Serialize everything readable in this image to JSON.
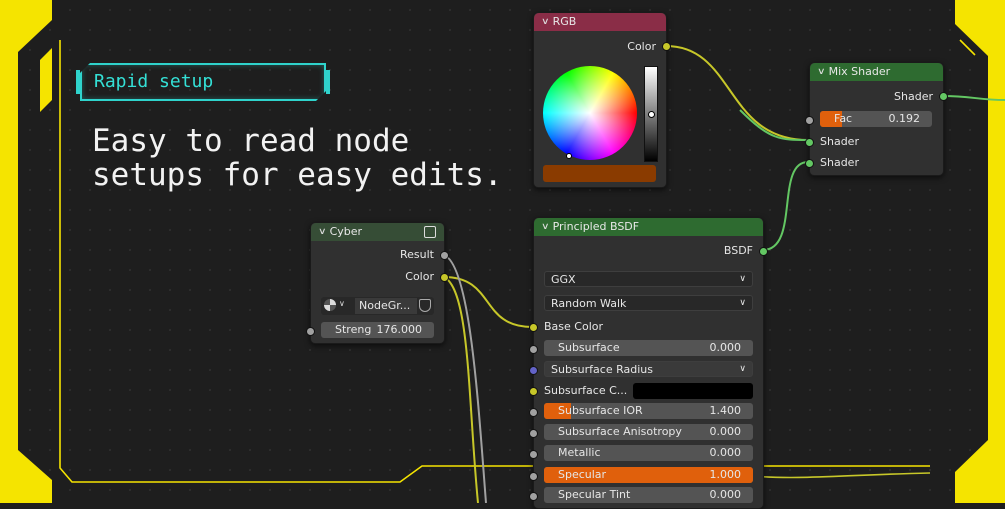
{
  "badge": {
    "label": "Rapid setup"
  },
  "headline": {
    "text": "Easy to read node\nsetups for easy edits."
  },
  "nodes": {
    "rgb": {
      "title": "RGB",
      "output_color_label": "Color",
      "header_color": "#8a2d47",
      "swatch_color": "#8a3b00"
    },
    "mix_shader": {
      "title": "Mix Shader",
      "output_label": "Shader",
      "fac_label": "Fac",
      "fac_value": "0.192",
      "fac_level": 0.192,
      "input_shader_1": "Shader",
      "input_shader_2": "Shader",
      "header_color": "#2e6b30"
    },
    "cyber": {
      "title": "Cyber",
      "output_result": "Result",
      "output_color": "Color",
      "nodegroup_label": "NodeGr...",
      "strength_label": "Streng",
      "strength_value": "176.000",
      "header_color": "#364d36"
    },
    "principled": {
      "title": "Principled BSDF",
      "output_label": "BSDF",
      "distribution": "GGX",
      "subsurface_method": "Random Walk",
      "base_color_label": "Base Color",
      "rows": [
        {
          "label": "Subsurface",
          "value": "0.000",
          "level": 0
        },
        {
          "label": "Subsurface IOR",
          "value": "1.400",
          "level": 0.2
        },
        {
          "label": "Subsurface Anisotropy",
          "value": "0.000",
          "level": 0
        },
        {
          "label": "Metallic",
          "value": "0.000",
          "level": 0
        },
        {
          "label": "Specular",
          "value": "1.000",
          "level": 1
        },
        {
          "label": "Specular Tint",
          "value": "0.000",
          "level": 0
        }
      ],
      "subsurface_radius_label": "Subsurface Radius",
      "subsurface_color_label": "Subsurface C...",
      "header_color": "#2e6b30"
    }
  },
  "colors": {
    "frame_yellow": "#f5e400",
    "accent_cyan": "#2fd3cc",
    "socket_yellow": "#c7c729",
    "socket_green": "#63c763",
    "socket_grey": "#a1a1a1",
    "socket_purple": "#6363c7"
  }
}
